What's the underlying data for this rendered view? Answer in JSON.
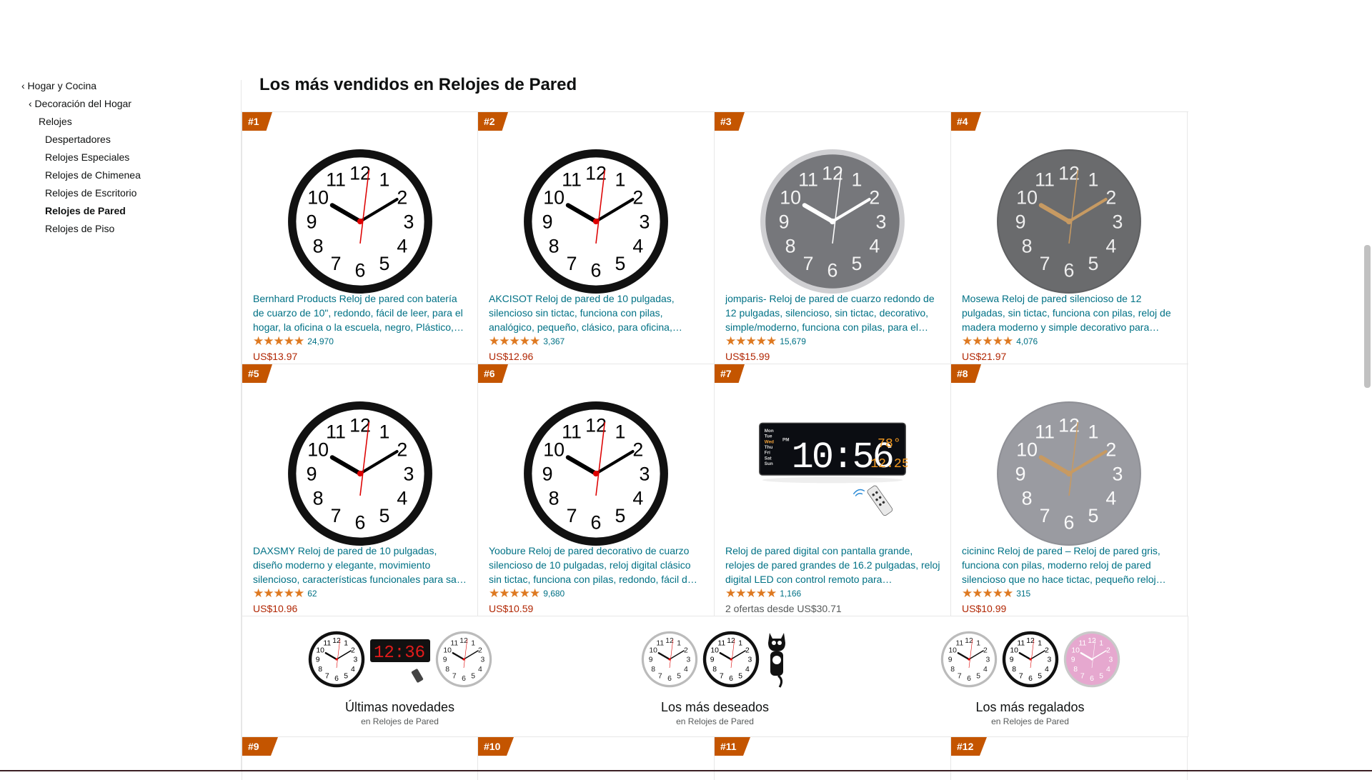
{
  "nav": {
    "items": [
      {
        "label": "‹ Hogar y Cocina",
        "level": 0,
        "bold": false
      },
      {
        "label": "‹ Decoración del Hogar",
        "level": 1,
        "bold": false
      },
      {
        "label": "Relojes",
        "level": 2,
        "bold": false
      },
      {
        "label": "Despertadores",
        "level": 3,
        "bold": false
      },
      {
        "label": "Relojes Especiales",
        "level": 3,
        "bold": false
      },
      {
        "label": "Relojes de Chimenea",
        "level": 3,
        "bold": false
      },
      {
        "label": "Relojes de Escritorio",
        "level": 3,
        "bold": false
      },
      {
        "label": "Relojes de Pared",
        "level": 3,
        "bold": true
      },
      {
        "label": "Relojes de Piso",
        "level": 3,
        "bold": false
      }
    ]
  },
  "page_title": "Los más vendidos en Relojes de Pared",
  "products": [
    {
      "rank": "#1",
      "title": "Bernhard Products Reloj de pared con batería de cuarzo de 10\", redondo, fácil de leer, para el hogar, la oficina o la escuela, negro, Plástico,…",
      "stars": "★★★★★",
      "reviews": "24,970",
      "price": "US$13.97",
      "image": "black-frame-clock",
      "style": "black"
    },
    {
      "rank": "#2",
      "title": "AKCISOT Reloj de pared de 10 pulgadas, silencioso sin tictac, funciona con pilas, analógico, pequeño, clásico, para oficina,…",
      "stars": "★★★★★",
      "reviews": "3,367",
      "price": "US$12.96",
      "image": "black-frame-clock",
      "style": "black"
    },
    {
      "rank": "#3",
      "title": "jomparis- Reloj de pared de cuarzo redondo de 12 pulgadas, silencioso, sin tictac, decorativo, simple/moderno, funciona con pilas, para el…",
      "stars": "★★★★★",
      "reviews": "15,679",
      "price": "US$15.99",
      "image": "gray-modern-clock",
      "style": "gray"
    },
    {
      "rank": "#4",
      "title": "Mosewa Reloj de pared silencioso de 12 pulgadas, sin tictac, funciona con pilas, reloj de madera moderno y simple decorativo para…",
      "stars": "★★★★★",
      "reviews": "4,076",
      "price": "US$21.97",
      "image": "dark-gray-wood-clock",
      "style": "darkgray"
    },
    {
      "rank": "#5",
      "title": "DAXSMY Reloj de pared de 10 pulgadas, diseño moderno y elegante, movimiento silencioso, características funcionales para sala de estar,…",
      "stars": "★★★★★",
      "reviews": "62",
      "price": "US$10.96",
      "image": "black-frame-clock",
      "style": "black"
    },
    {
      "rank": "#6",
      "title": "Yoobure Reloj de pared decorativo de cuarzo silencioso de 10 pulgadas, reloj digital clásico sin tictac, funciona con pilas, redondo, fácil d…",
      "stars": "★★★★★",
      "reviews": "9,680",
      "price": "US$10.59",
      "image": "black-frame-clock",
      "style": "black"
    },
    {
      "rank": "#7",
      "title": "Reloj de pared digital con pantalla grande, relojes de pared grandes de 16.2 pulgadas, reloj digital LED con control remoto para…",
      "stars": "★★★★★",
      "reviews": "1,166",
      "offers": "2 ofertas desde US$30.71",
      "image": "digital-led-clock",
      "style": "digital",
      "digital": {
        "days": [
          "Mon",
          "Tue",
          "Wed",
          "Thu",
          "Fri",
          "Sat",
          "Sun"
        ],
        "ampm": "PM",
        "time": "10:56",
        "temp": "78°",
        "date": "12.25"
      }
    },
    {
      "rank": "#8",
      "title": "cicininc Reloj de pared – Reloj de pared gris, funciona con pilas, moderno reloj de pared silencioso que no hace tictac, pequeño reloj…",
      "stars": "★★★★★",
      "reviews": "315",
      "price": "US$10.99",
      "image": "light-gray-clock",
      "style": "lightgray"
    }
  ],
  "promos": [
    {
      "label": "Últimas novedades",
      "sub": "en Relojes de Pared"
    },
    {
      "label": "Los más deseados",
      "sub": "en Relojes de Pared"
    },
    {
      "label": "Los más regalados",
      "sub": "en Relojes de Pared"
    }
  ],
  "next_ranks": [
    "#9",
    "#10",
    "#11",
    "#12"
  ],
  "colors": {
    "link": "#007185",
    "price": "#b12704",
    "rank_badge": "#c45500",
    "star": "#de7921"
  }
}
